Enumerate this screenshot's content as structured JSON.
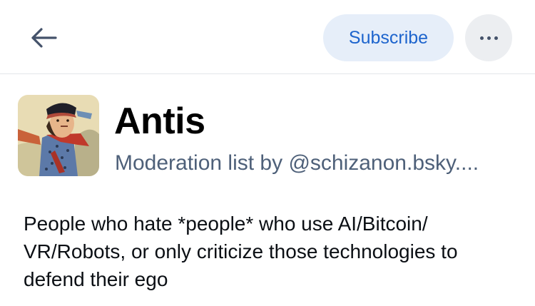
{
  "header": {
    "back_icon": "arrow-left-icon",
    "subscribe_label": "Subscribe",
    "more_icon": "ellipsis-icon"
  },
  "list": {
    "title": "Antis",
    "subtitle": "Moderation list by @schizanon.bsky....",
    "avatar_alt": "illustrated figure in a dark hat and spotted coat",
    "description": "People who hate *people* who use AI/Bitcoin/ VR/Robots, or only criticize those technologies to defend their ego"
  },
  "colors": {
    "accent": "#1d64cd",
    "subscribe_bg": "#e6eef9",
    "muted_text": "#4e6079",
    "divider": "#e3e6ea"
  }
}
